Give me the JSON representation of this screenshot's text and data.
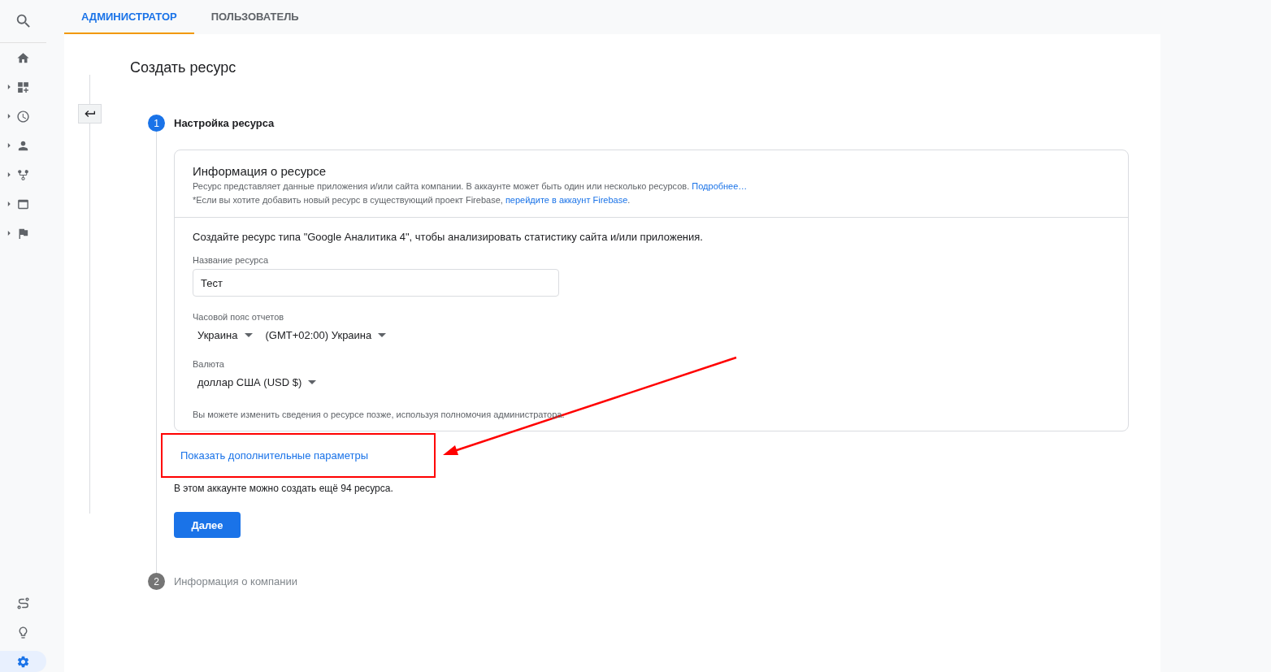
{
  "sidebar": {
    "top_items": [
      {
        "kind": "link"
      },
      {
        "kind": "group",
        "expanded": false
      },
      {
        "kind": "group",
        "expanded": false
      },
      {
        "kind": "group",
        "expanded": false
      },
      {
        "kind": "group",
        "expanded": false
      },
      {
        "kind": "group",
        "expanded": false
      },
      {
        "kind": "group",
        "expanded": false
      }
    ],
    "bottom_items": [
      {
        "selected": false
      },
      {
        "selected": false
      },
      {
        "selected": true
      }
    ]
  },
  "tabs": [
    {
      "label": "АДМИНИСТРАТОР",
      "selected": true
    },
    {
      "label": "ПОЛЬЗОВАТЕЛЬ",
      "selected": false
    }
  ],
  "page_title": "Создать ресурс",
  "steps": [
    {
      "number": "1",
      "label": "Настройка ресурса",
      "active": true
    },
    {
      "number": "2",
      "label": "Информация о компании",
      "active": false
    }
  ],
  "card": {
    "title": "Информация о ресурсе",
    "description": "Ресурс представляет данные приложения и/или сайта компании. В аккаунте может быть один или несколько ресурсов.",
    "description_link": "Подробнее…",
    "note": "*Если вы хотите добавить новый ресурс в существующий проект Firebase,",
    "note_link": "перейдите в аккаунт Firebase",
    "note_end": ".",
    "intro": "Создайте ресурс типа \"Google Аналитика 4\", чтобы анализировать статистику сайта и/или приложения.",
    "name_field": {
      "label": "Название ресурса",
      "value": "Тест"
    },
    "timezone": {
      "label": "Часовой пояс отчетов",
      "dropdowns": [
        "Украина",
        "(GMT+02:00) Украина"
      ]
    },
    "currency": {
      "label": "Валюта",
      "dropdowns": [
        "доллар США (USD $)"
      ]
    },
    "footnote": "Вы можете изменить сведения о ресурсе позже, используя полномочия администратора."
  },
  "advanced_link": "Показать дополнительные параметры",
  "quota_text": "В этом аккаунте можно создать ещё 94 ресурса.",
  "next_button": "Далее",
  "annotations": {
    "highlight_frame": true,
    "arrow": true
  }
}
